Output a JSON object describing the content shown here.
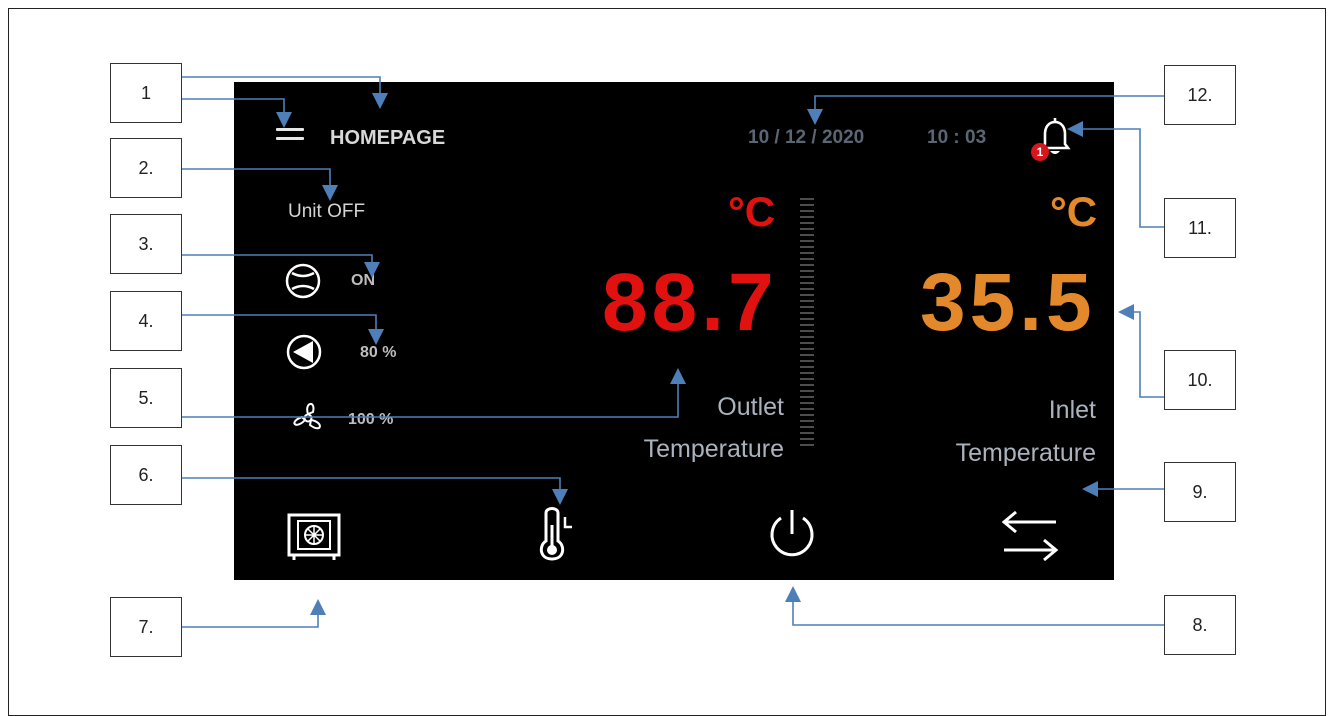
{
  "header": {
    "title": "HOMEPAGE",
    "date": "10 / 12 / 2020",
    "time": "10 : 03",
    "notification_count": "1"
  },
  "status": {
    "unit": "Unit OFF",
    "compressor": "ON",
    "pump": "80 %",
    "fan": "100 %"
  },
  "outlet": {
    "unit": "°C",
    "value": "88.7",
    "label_line1": "Outlet",
    "label_line2": "Temperature",
    "color": "#e0110f"
  },
  "inlet": {
    "unit": "°C",
    "value": "35.5",
    "label_line1": "Inlet",
    "label_line2": "Temperature",
    "color": "#e3892c"
  },
  "bottom_nav": [
    {
      "icon": "unit-fan-icon"
    },
    {
      "icon": "thermometer-icon"
    },
    {
      "icon": "power-icon"
    },
    {
      "icon": "swap-arrows-icon"
    }
  ],
  "callouts": [
    "1",
    "2.",
    "3.",
    "4.",
    "5.",
    "6.",
    "7.",
    "8.",
    "9.",
    "10.",
    "11.",
    "12."
  ],
  "colors": {
    "background": "#000000",
    "arrow": "#4f7fb8"
  }
}
